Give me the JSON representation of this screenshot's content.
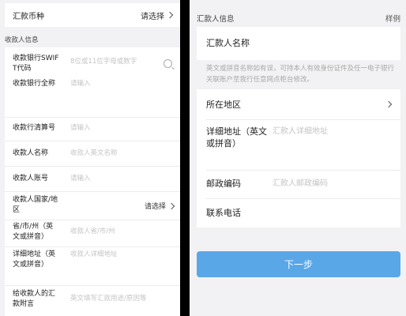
{
  "left": {
    "currency": {
      "label": "汇款币种",
      "value": "请选择"
    },
    "section_title": "收款人信息",
    "fields": {
      "swift": {
        "label": "收款银行SWIFT代码",
        "placeholder": "8位或11位字母或数字"
      },
      "bank_name": {
        "label": "收款银行全称",
        "placeholder": "请输入"
      },
      "clearing": {
        "label": "收款行清算号",
        "placeholder": "请输入"
      },
      "payee_name": {
        "label": "收款人名称",
        "placeholder": "收款人英文名称"
      },
      "account": {
        "label": "收款人账号",
        "placeholder": "请输入"
      },
      "country": {
        "label": "收款人国家/地区",
        "value": "请选择"
      },
      "province": {
        "label": "省/市/州（英文或拼音）",
        "placeholder": "收款人省/市/州"
      },
      "address": {
        "label": "详细地址（英文或拼音）",
        "placeholder": "收款人详细地址"
      },
      "remark": {
        "label": "给收款人的汇款附言",
        "placeholder": "英文填写汇款用途/原因等"
      }
    }
  },
  "right": {
    "section_title": "汇款人信息",
    "sample_link": "样例",
    "remitter_name": "汇款人名称",
    "note": "英文或拼音名称如有误，可持本人有效身份证件及任一电子银行关联账户至我行任意网点柜台修改。",
    "region": {
      "label": "所在地区"
    },
    "address": {
      "label": "详细地址（英文或拼音）",
      "placeholder": "汇款人详细地址"
    },
    "postcode": {
      "label": "邮政编码",
      "placeholder": "汇款人邮政编码"
    },
    "phone": {
      "label": "联系电话"
    },
    "next_button": "下一步"
  }
}
